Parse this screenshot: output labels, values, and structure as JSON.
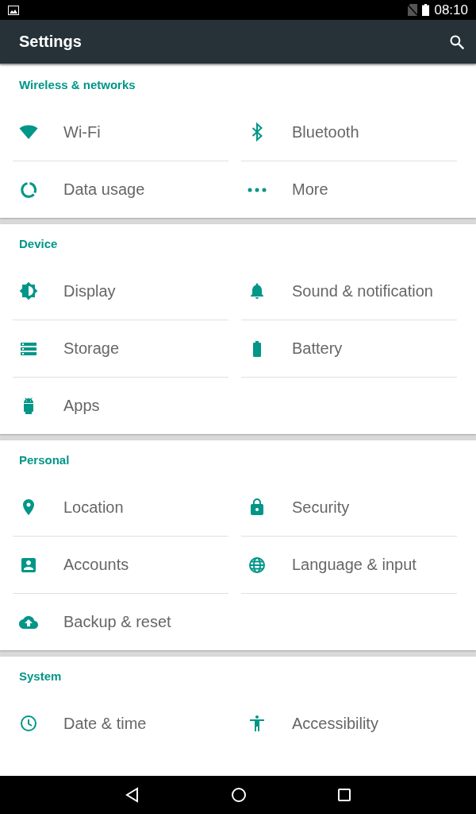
{
  "status_bar": {
    "time": "08:10"
  },
  "app_bar": {
    "title": "Settings"
  },
  "sections": [
    {
      "title": "Wireless & networks",
      "rows": [
        [
          {
            "label": "Wi-Fi"
          },
          {
            "label": "Bluetooth"
          }
        ],
        [
          {
            "label": "Data usage"
          },
          {
            "label": "More"
          }
        ]
      ]
    },
    {
      "title": "Device",
      "rows": [
        [
          {
            "label": "Display"
          },
          {
            "label": "Sound & notification"
          }
        ],
        [
          {
            "label": "Storage"
          },
          {
            "label": "Battery"
          }
        ],
        [
          {
            "label": "Apps"
          }
        ]
      ]
    },
    {
      "title": "Personal",
      "rows": [
        [
          {
            "label": "Location"
          },
          {
            "label": "Security"
          }
        ],
        [
          {
            "label": "Accounts"
          },
          {
            "label": "Language & input"
          }
        ],
        [
          {
            "label": "Backup & reset"
          }
        ]
      ]
    },
    {
      "title": "System",
      "rows": [
        [
          {
            "label": "Date & time"
          },
          {
            "label": "Accessibility"
          }
        ]
      ]
    }
  ]
}
